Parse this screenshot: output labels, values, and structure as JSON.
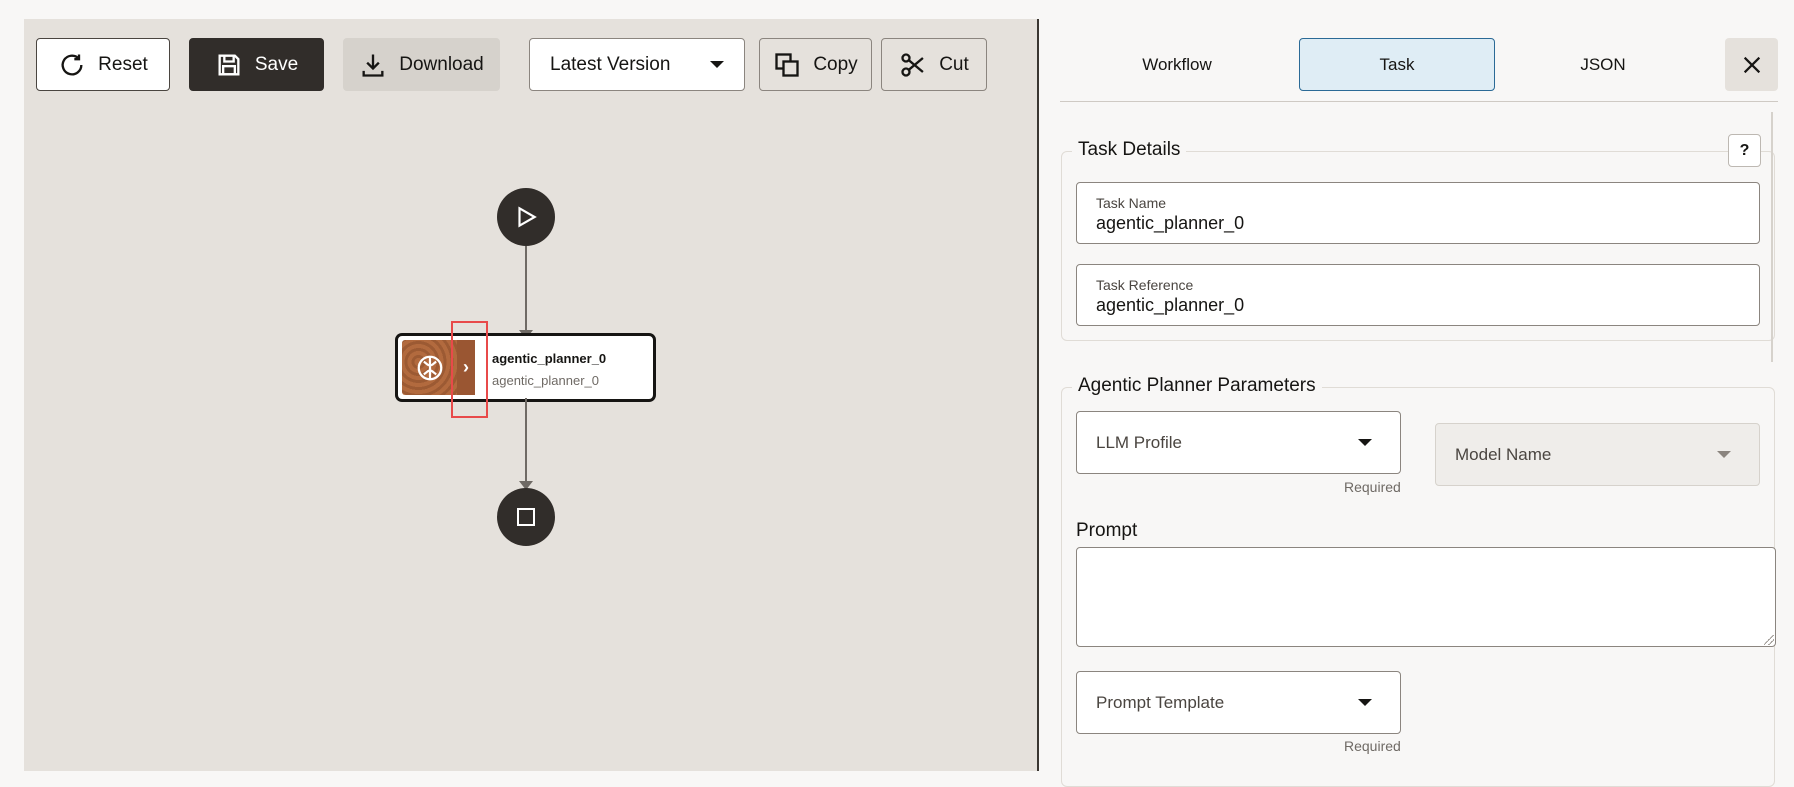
{
  "toolbar": {
    "reset_label": "Reset",
    "save_label": "Save",
    "download_label": "Download",
    "version_value": "Latest Version",
    "copy_label": "Copy",
    "cut_label": "Cut"
  },
  "canvas": {
    "task_node": {
      "title": "agentic_planner_0",
      "subtitle": "agentic_planner_0",
      "icon": "brain-icon",
      "expand_glyph": "›"
    }
  },
  "panel": {
    "tabs": [
      {
        "label": "Workflow",
        "active": false
      },
      {
        "label": "Task",
        "active": true
      },
      {
        "label": "JSON",
        "active": false
      }
    ],
    "task_details": {
      "legend": "Task Details",
      "help": "?",
      "task_name_label": "Task Name",
      "task_name_value": "agentic_planner_0",
      "task_reference_label": "Task Reference",
      "task_reference_value": "agentic_planner_0"
    },
    "agentic_params": {
      "legend": "Agentic Planner Parameters",
      "llm_profile_label": "LLM Profile",
      "model_name_label": "Model Name",
      "required_text": "Required",
      "prompt_label": "Prompt",
      "prompt_value": "",
      "prompt_template_label": "Prompt Template",
      "required_text_2": "Required"
    }
  },
  "colors": {
    "accent_dark": "#312d2a",
    "tab_active_bg": "#dfedf5",
    "tab_active_border": "#2b6a96",
    "node_brown": "#9a5632",
    "highlight_red": "#e84a4a"
  }
}
